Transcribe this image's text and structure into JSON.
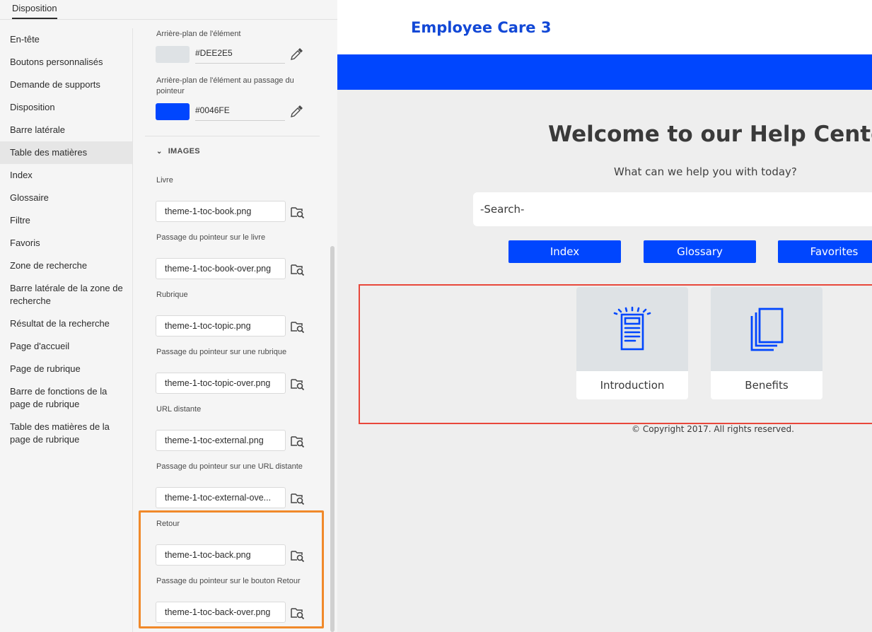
{
  "tabs": {
    "active": "Disposition"
  },
  "nav": {
    "items": [
      "En-tête",
      "Boutons personnalisés",
      "Demande de supports",
      "Disposition",
      "Barre latérale",
      "Table des matières",
      "Index",
      "Glossaire",
      "Filtre",
      "Favoris",
      "Zone de recherche",
      "Barre latérale de la zone de recherche",
      "Résultat de la recherche",
      "Page d'accueil",
      "Page de rubrique",
      "Barre de fonctions de la page de rubrique",
      "Table des matières de la page de rubrique"
    ],
    "active_item": "Table des matières"
  },
  "props": {
    "item_bg": {
      "label": "Arrière-plan de l'élément",
      "value": "#DEE2E5",
      "color": "#DEE2E5"
    },
    "item_hover_bg": {
      "label": "Arrière-plan de l'élément au passage du pointeur",
      "value": "#0046FE",
      "color": "#0046FE"
    },
    "images_section": "IMAGES",
    "images": {
      "book": {
        "label": "Livre",
        "value": "theme-1-toc-book.png"
      },
      "book_over": {
        "label": "Passage du pointeur sur le livre",
        "value": "theme-1-toc-book-over.png"
      },
      "topic": {
        "label": "Rubrique",
        "value": "theme-1-toc-topic.png"
      },
      "topic_over": {
        "label": "Passage du pointeur sur une rubrique",
        "value": "theme-1-toc-topic-over.png"
      },
      "external": {
        "label": "URL distante",
        "value": "theme-1-toc-external.png"
      },
      "external_over": {
        "label": "Passage du pointeur sur une URL distante",
        "value": "theme-1-toc-external-ove..."
      },
      "back": {
        "label": "Retour",
        "value": "theme-1-toc-back.png"
      },
      "back_over": {
        "label": "Passage du pointeur sur le bouton Retour",
        "value": "theme-1-toc-back-over.png"
      }
    }
  },
  "preview": {
    "brand": "Employee Care 3",
    "welcome": "Welcome to our Help Center",
    "subtitle": "What can we help you with today?",
    "search_placeholder": "-Search-",
    "buttons": {
      "index": "Index",
      "glossary": "Glossary",
      "favorites": "Favorites"
    },
    "cards": {
      "introduction": "Introduction",
      "benefits": "Benefits"
    },
    "copyright": "© Copyright 2017. All rights reserved."
  },
  "colors": {
    "accent_blue": "#0046FE",
    "item_bg": "#DEE2E5",
    "highlight_orange": "#F0892A",
    "highlight_red": "#E8473B",
    "brand_text": "#1248D6"
  },
  "icons": [
    "eyedropper-icon",
    "browse-folder-icon",
    "chevron-down-icon",
    "document-icon",
    "copy-pages-icon"
  ]
}
